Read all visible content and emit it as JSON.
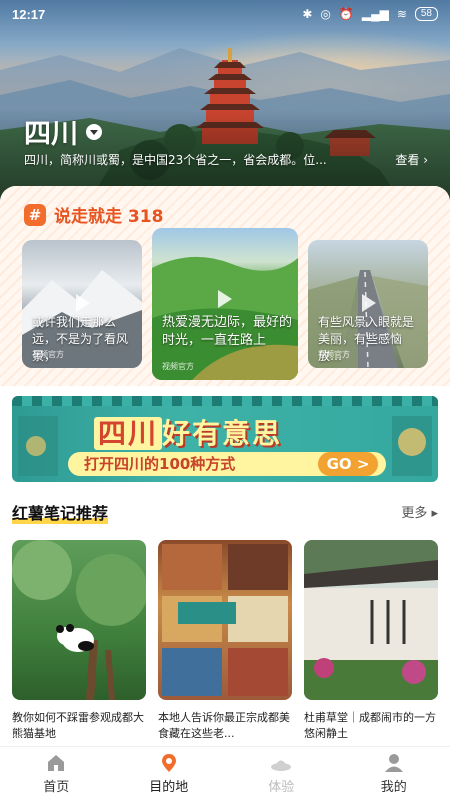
{
  "status_bar": {
    "time": "12:17",
    "battery": "58"
  },
  "hero": {
    "city": "四川",
    "description": "四川，简称川或蜀，是中国23个省之一，省会成都。位...",
    "view_more": "查看 ›"
  },
  "topic": {
    "title": "说走就走 318",
    "cards": [
      {
        "caption": "或许我们走那么远，不是为了看风景，",
        "source": "视频官方"
      },
      {
        "caption": "热爱漫无边际，最好的时光，一直在路上",
        "source": "视频官方"
      },
      {
        "caption": "有些风景入眼就是美丽，有些感恼放…",
        "source": "视频官方"
      }
    ]
  },
  "banner": {
    "title_part1": "四川",
    "title_part2": "好有意思",
    "subtitle": "打开四川的100种方式",
    "go_label": "GO >"
  },
  "notes_section": {
    "title": "红薯笔记推荐",
    "more": "更多 ▸",
    "items": [
      {
        "text": "教你如何不踩雷参观成都大熊猫基地"
      },
      {
        "text": "本地人告诉你最正宗成都美食藏在这些老..."
      },
      {
        "text": "杜甫草堂｜成都闹市的一方悠闲静土"
      }
    ]
  },
  "bottom_nav": [
    {
      "label": "首页",
      "icon": "home-icon"
    },
    {
      "label": "目的地",
      "icon": "location-pin-icon"
    },
    {
      "label": "体验",
      "icon": "hat-icon"
    },
    {
      "label": "我的",
      "icon": "person-icon"
    }
  ],
  "colors": {
    "accent": "#f26c2c",
    "title_orange": "#e8531f",
    "banner_teal": "#34a79e"
  }
}
